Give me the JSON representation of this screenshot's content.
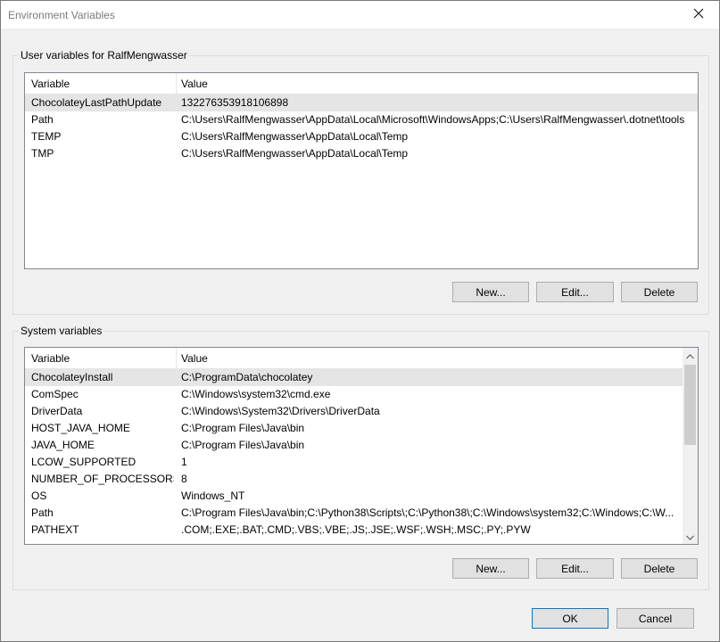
{
  "window": {
    "title": "Environment Variables"
  },
  "user_vars": {
    "group_label": "User variables for RalfMengwasser",
    "columns": [
      "Variable",
      "Value"
    ],
    "rows": [
      {
        "name": "ChocolateyLastPathUpdate",
        "value": "132276353918106898"
      },
      {
        "name": "Path",
        "value": "C:\\Users\\RalfMengwasser\\AppData\\Local\\Microsoft\\WindowsApps;C:\\Users\\RalfMengwasser\\.dotnet\\tools"
      },
      {
        "name": "TEMP",
        "value": "C:\\Users\\RalfMengwasser\\AppData\\Local\\Temp"
      },
      {
        "name": "TMP",
        "value": "C:\\Users\\RalfMengwasser\\AppData\\Local\\Temp"
      }
    ],
    "selected_index": 0,
    "buttons": {
      "new": "New...",
      "edit": "Edit...",
      "delete": "Delete"
    }
  },
  "system_vars": {
    "group_label": "System variables",
    "columns": [
      "Variable",
      "Value"
    ],
    "rows": [
      {
        "name": "ChocolateyInstall",
        "value": "C:\\ProgramData\\chocolatey"
      },
      {
        "name": "ComSpec",
        "value": "C:\\Windows\\system32\\cmd.exe"
      },
      {
        "name": "DriverData",
        "value": "C:\\Windows\\System32\\Drivers\\DriverData"
      },
      {
        "name": "HOST_JAVA_HOME",
        "value": "C:\\Program Files\\Java\\bin"
      },
      {
        "name": "JAVA_HOME",
        "value": "C:\\Program Files\\Java\\bin"
      },
      {
        "name": "LCOW_SUPPORTED",
        "value": "1"
      },
      {
        "name": "NUMBER_OF_PROCESSORS",
        "value": "8"
      },
      {
        "name": "OS",
        "value": "Windows_NT"
      },
      {
        "name": "Path",
        "value": "C:\\Program Files\\Java\\bin;C:\\Python38\\Scripts\\;C:\\Python38\\;C:\\Windows\\system32;C:\\Windows;C:\\W..."
      },
      {
        "name": "PATHEXT",
        "value": ".COM;.EXE;.BAT;.CMD;.VBS;.VBE;.JS;.JSE;.WSF;.WSH;.MSC;.PY;.PYW"
      }
    ],
    "selected_index": 0,
    "buttons": {
      "new": "New...",
      "edit": "Edit...",
      "delete": "Delete"
    }
  },
  "footer": {
    "ok": "OK",
    "cancel": "Cancel"
  },
  "icons": {
    "close": "close-icon",
    "scroll_up": "chevron-up-icon",
    "scroll_down": "chevron-down-icon"
  }
}
